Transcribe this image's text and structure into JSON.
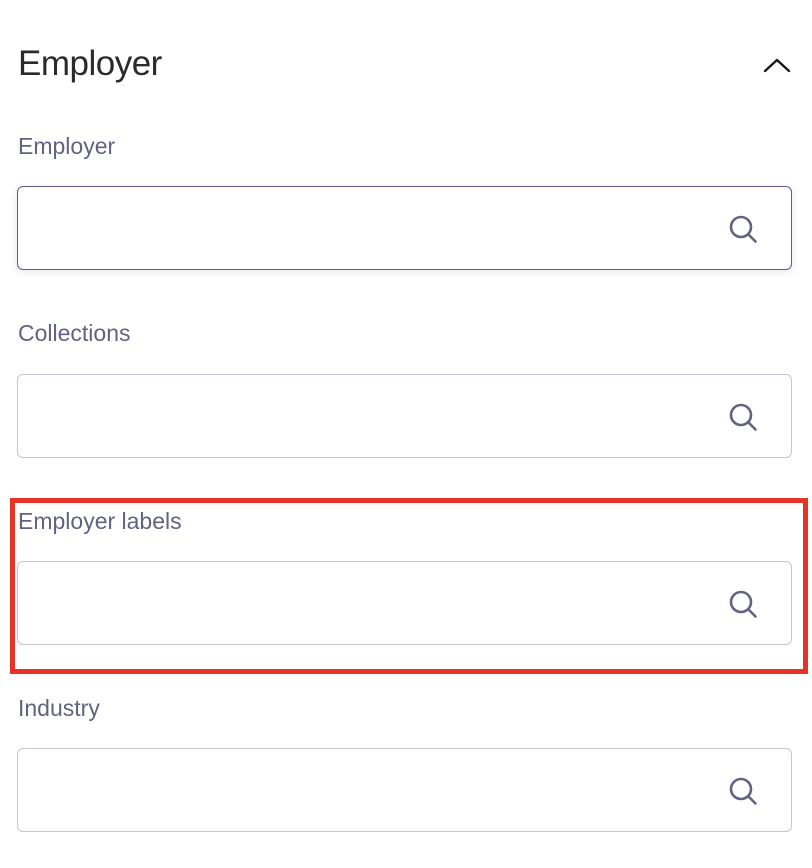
{
  "section": {
    "title": "Employer",
    "toggle_icon": "chevron-up-icon"
  },
  "fields": [
    {
      "label": "Employer",
      "value": "",
      "placeholder": "",
      "icon": "search-icon",
      "focused": true
    },
    {
      "label": "Collections",
      "value": "",
      "placeholder": "",
      "icon": "search-icon",
      "focused": false
    },
    {
      "label": "Employer labels",
      "value": "",
      "placeholder": "",
      "icon": "search-icon",
      "focused": false,
      "highlighted": true
    },
    {
      "label": "Industry",
      "value": "",
      "placeholder": "",
      "icon": "search-icon",
      "focused": false
    }
  ],
  "colors": {
    "title": "#2b2b2b",
    "label": "#636280",
    "border": "#c6c5d4",
    "focus_border": "#5e5d86",
    "icon": "#636280",
    "highlight": "#e53325"
  }
}
